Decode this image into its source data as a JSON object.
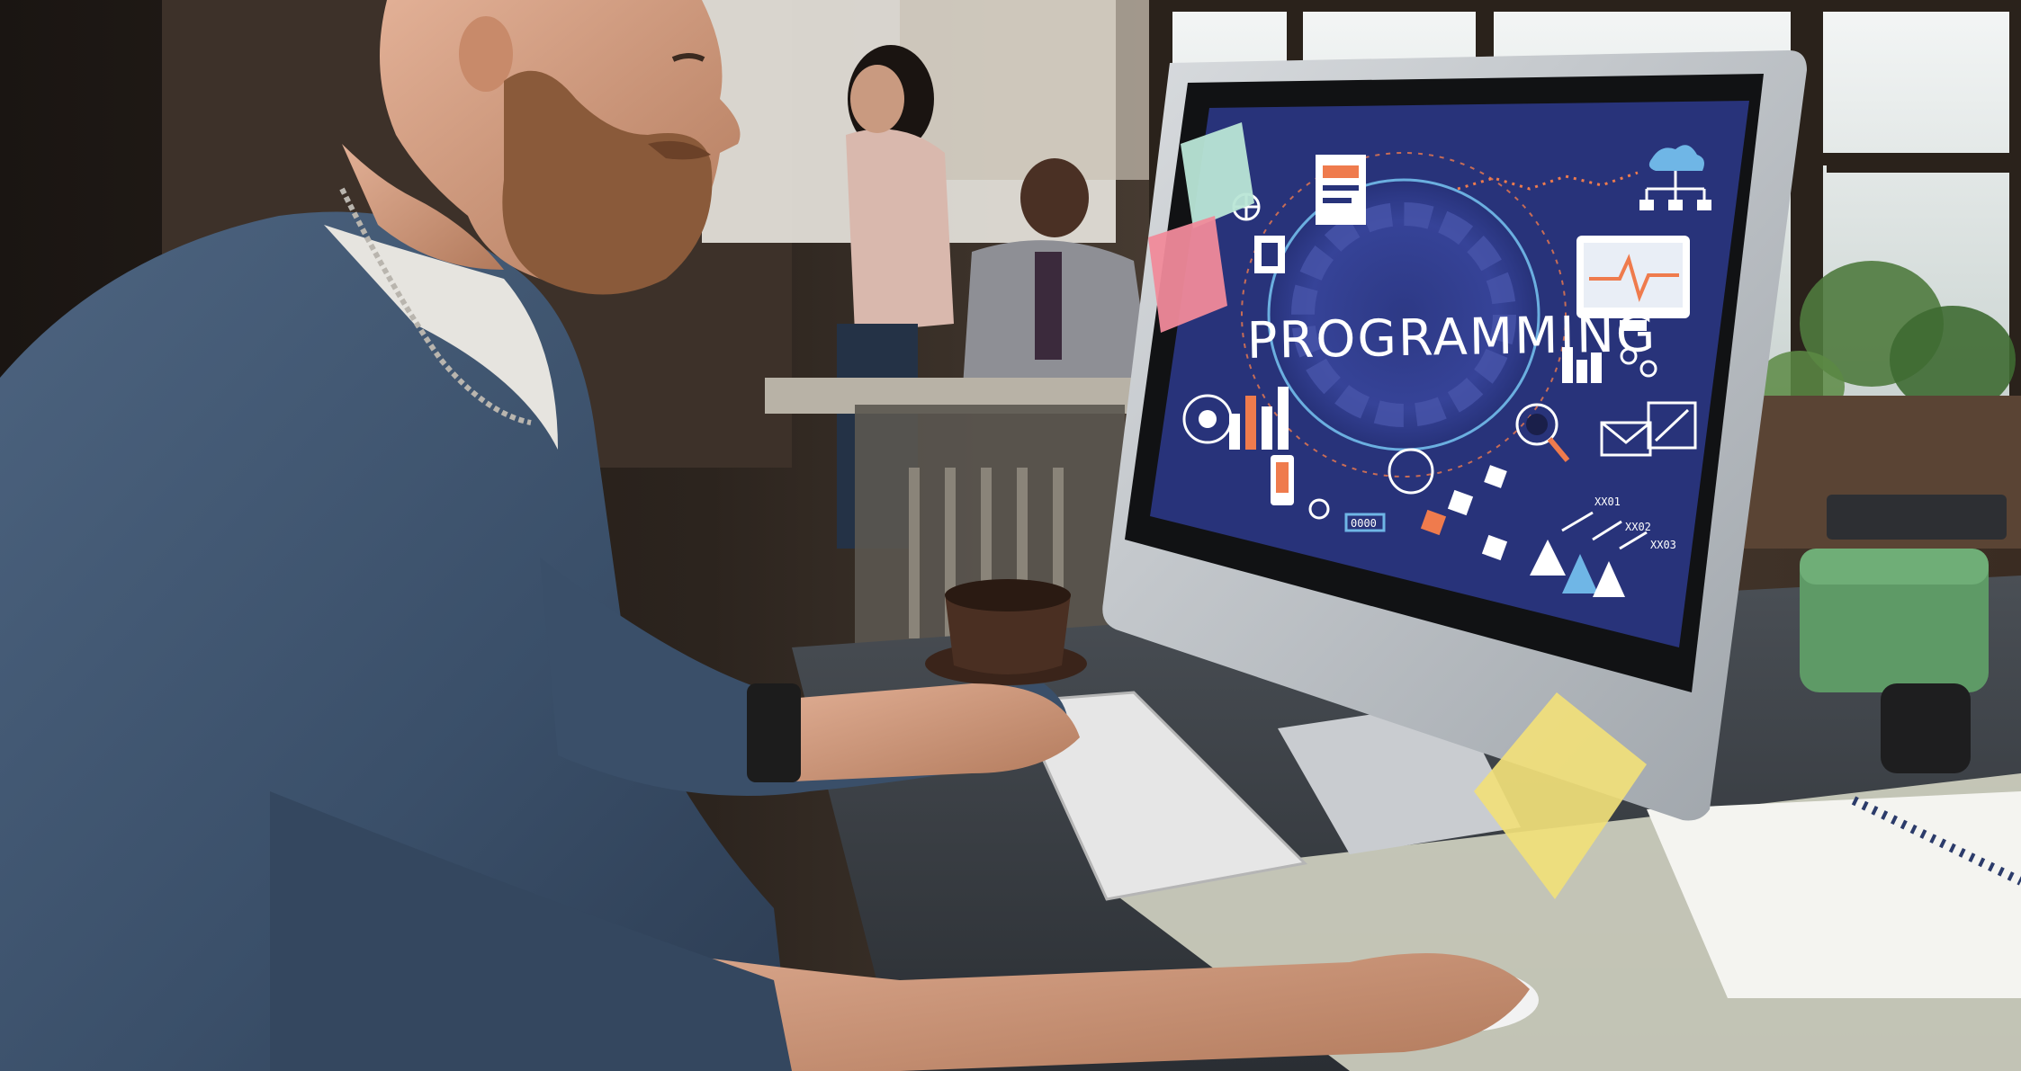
{
  "photo": {
    "screen_title": "PROGRAMMING",
    "screen_labels": [
      "XX01",
      "XX02",
      "XX03"
    ],
    "screen_box_label": "0000"
  },
  "colors": {
    "screen_bg": "#28337a",
    "screen_ring": "#3a4694",
    "screen_line": "#6fb6e6",
    "screen_accent": "#ef7b4d",
    "sweater": "#3f5570",
    "skin": "#d19a7a",
    "beard": "#8a5a3a",
    "desk": "#3a3f45",
    "window_light": "#e9eef0",
    "sticky_yellow": "#f1e07a",
    "sticky_pink": "#f08a9a",
    "sticky_mint": "#b9e6d6",
    "green_case": "#5a9a63"
  }
}
